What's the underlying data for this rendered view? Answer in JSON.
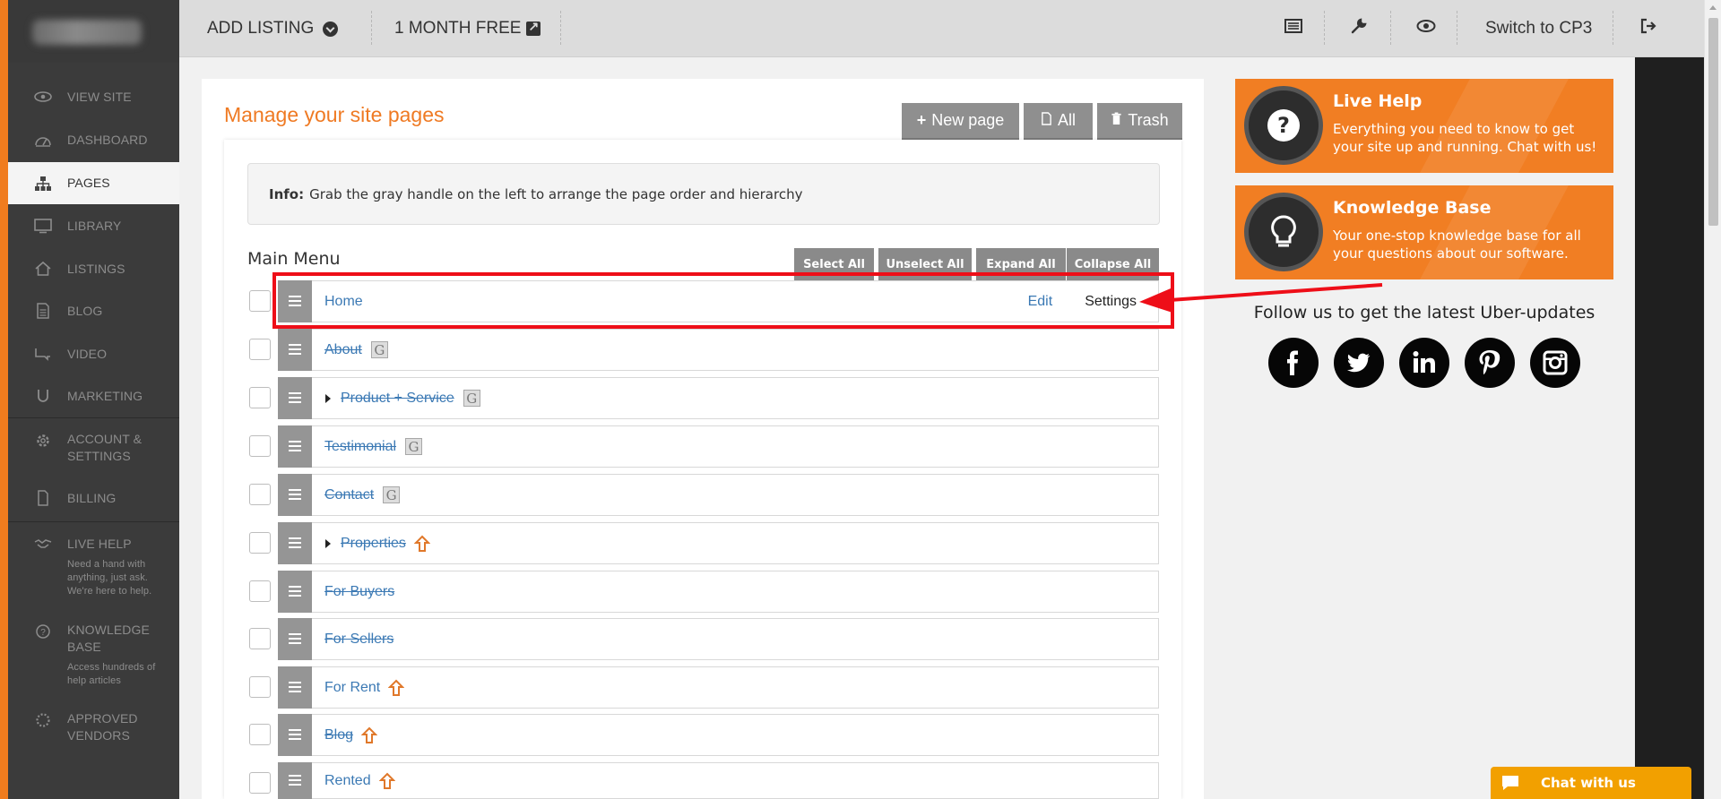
{
  "sidebar": {
    "items": [
      {
        "label": "VIEW SITE",
        "icon": "eye-icon"
      },
      {
        "label": "DASHBOARD",
        "icon": "gauge-icon"
      },
      {
        "label": "PAGES",
        "icon": "sitemap-icon"
      },
      {
        "label": "LIBRARY",
        "icon": "monitor-icon"
      },
      {
        "label": "LISTINGS",
        "icon": "home-icon"
      },
      {
        "label": "BLOG",
        "icon": "document-icon"
      },
      {
        "label": "VIDEO",
        "icon": "video-icon"
      },
      {
        "label": "MARKETING",
        "icon": "magnet-icon"
      },
      {
        "label": "ACCOUNT & SETTINGS",
        "icon": "gear-icon"
      },
      {
        "label": "BILLING",
        "icon": "file-icon"
      },
      {
        "label": "LIVE HELP",
        "icon": "handshake-icon",
        "desc": "Need a hand with anything, just ask. We're here to help."
      },
      {
        "label": "KNOWLEDGE BASE",
        "icon": "question-circle-icon",
        "desc": "Access hundreds of help articles"
      },
      {
        "label": "APPROVED VENDORS",
        "icon": "badge-icon"
      }
    ]
  },
  "topbar": {
    "add_listing": "ADD LISTING",
    "month_free": "1 MONTH FREE",
    "switch": "Switch to CP3"
  },
  "main": {
    "title": "Manage your site pages",
    "buttons": {
      "new_page": "New page",
      "all": "All",
      "trash": "Trash"
    },
    "info_label": "Info:",
    "info_text": "Grab the gray handle on the left to arrange the page order and hierarchy",
    "menu_title": "Main Menu",
    "menu_buttons": {
      "select_all": "Select All",
      "unselect_all": "Unselect All",
      "expand_all": "Expand All",
      "collapse_all": "Collapse All"
    },
    "rows": [
      {
        "label": "Home",
        "edit": "Edit",
        "settings": "Settings"
      },
      {
        "label": "About",
        "badge": "G"
      },
      {
        "label": "Product + Service",
        "badge": "G"
      },
      {
        "label": "Testimonial",
        "badge": "G"
      },
      {
        "label": "Contact",
        "badge": "G"
      },
      {
        "label": "Properties"
      },
      {
        "label": "For Buyers"
      },
      {
        "label": "For Sellers"
      },
      {
        "label": "For Rent"
      },
      {
        "label": "Blog"
      },
      {
        "label": "Rented"
      }
    ]
  },
  "right": {
    "live_help": {
      "title": "Live Help",
      "text": "Everything you need to know to get your site up and running. Chat with us!"
    },
    "knowledge": {
      "title": "Knowledge Base",
      "text": "Your one-stop knowledge base for all your questions about our software."
    },
    "follow": "Follow us to get the latest Uber-updates",
    "socials": [
      "facebook-icon",
      "twitter-icon",
      "linkedin-icon",
      "pinterest-icon",
      "instagram-icon"
    ]
  },
  "chat": {
    "label": "Chat with us"
  },
  "colors": {
    "accent": "#f17e23",
    "link": "#3b79b4",
    "annotation": "#ee0e18"
  }
}
